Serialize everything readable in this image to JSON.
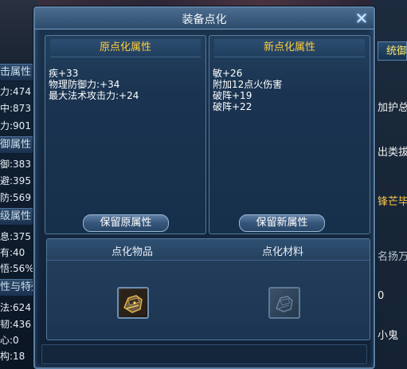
{
  "dialog": {
    "title": "装备点化",
    "close_icon": "close-icon"
  },
  "old_panel": {
    "header": "原点化属性",
    "attributes": [
      "疾+33",
      "物理防御力:+34",
      "最大法术攻击力:+24"
    ],
    "button": "保留原属性"
  },
  "new_panel": {
    "header": "新点化属性",
    "attributes": [
      "敏+26",
      "附加12点火伤害",
      "破阵+19",
      "破阵+22"
    ],
    "button": "保留新属性"
  },
  "bottom": {
    "item_label": "点化物品",
    "material_label": "点化材料",
    "item_icon": "gauntlet-icon",
    "material_icon": "gauntlet-ghost-icon"
  },
  "left_sidebar": {
    "headers": [
      "击属性",
      "御属性",
      "级属性",
      "性与特殊"
    ],
    "rows": [
      "力:474",
      "中:873",
      "力:901",
      "御:383",
      "避:395",
      "防:569",
      "息:375",
      "有:40",
      "悟:56%",
      "法:624",
      "韧:436",
      "心:0",
      "构:18"
    ]
  },
  "right_sidebar": {
    "tab": "统御",
    "texts": [
      "加护总",
      "出类拔",
      "锋芒毕",
      "名扬万",
      "0",
      "小鬼"
    ]
  },
  "colors": {
    "header_gold": "#ffcc3a",
    "panel_border": "#56799b",
    "dialog_bg": "#1d3550"
  }
}
